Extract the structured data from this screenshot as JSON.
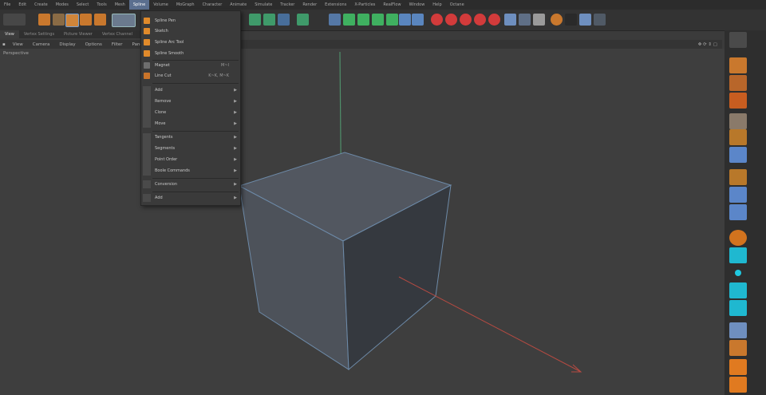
{
  "menubar": {
    "items": [
      "File",
      "Edit",
      "Create",
      "Modes",
      "Select",
      "Tools",
      "Mesh",
      "Spline",
      "Volume",
      "MoGraph",
      "Character",
      "Animate",
      "Simulate",
      "Tracker",
      "Render",
      "Extensions",
      "X-Particles",
      "RealFlow",
      "Window",
      "Help",
      "Octane"
    ],
    "active_index": 7
  },
  "tabs": {
    "items": [
      "View",
      "Vertex Settings",
      "Picture Viewer",
      "Vertex Channel"
    ]
  },
  "viewport_menu": {
    "items": [
      "View",
      "Camera",
      "Display",
      "Options",
      "Filter",
      "Panel"
    ],
    "label": "Perspective"
  },
  "spline_menu": {
    "items": [
      {
        "label": "Spline Pen",
        "icon_color": "#e08a2b"
      },
      {
        "label": "Sketch",
        "icon_color": "#e08a2b"
      },
      {
        "label": "Spline Arc Tool",
        "icon_color": "#e08a2b"
      },
      {
        "label": "Spline Smooth",
        "icon_color": "#e08a2b"
      },
      {
        "label": "Magnet",
        "shortcut": "M~I",
        "icon_color": "#6e6e6e"
      },
      {
        "label": "Line Cut",
        "shortcut": "K~K, M~K",
        "icon_color": "#c9742a"
      }
    ],
    "groups": [
      {
        "label": "Add",
        "arrow": "▶"
      },
      {
        "label": "Remove",
        "arrow": "▶"
      },
      {
        "label": "Clone",
        "arrow": "▶"
      },
      {
        "label": "Move",
        "arrow": "▶"
      },
      {
        "label": "Tangents",
        "arrow": "▶"
      },
      {
        "label": "Segments",
        "arrow": "▶"
      },
      {
        "label": "Point Order",
        "arrow": "▶"
      },
      {
        "label": "Boole Commands",
        "arrow": "▶"
      },
      {
        "label": "Conversion",
        "arrow": "▶"
      },
      {
        "label": "Add",
        "arrow": "▶"
      }
    ]
  },
  "colors": {
    "accent": "#5b6f8f",
    "cube_fill": "#4d525a",
    "cube_edge": "#6d8aa8",
    "y_axis": "#4f8f6a",
    "x_axis": "#b54a42"
  }
}
